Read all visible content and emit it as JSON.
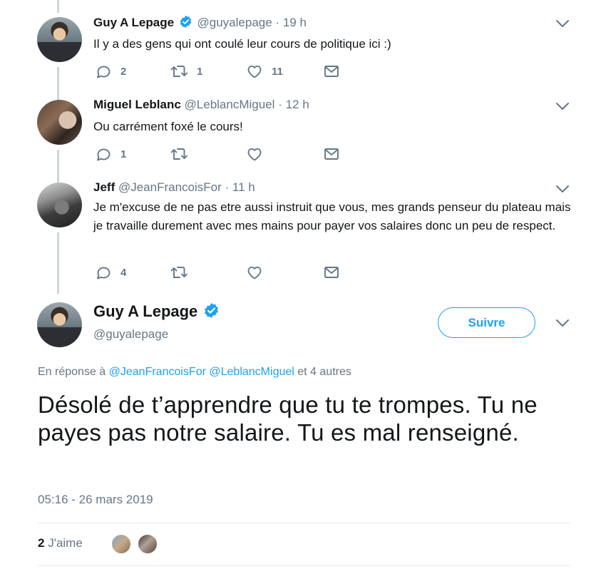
{
  "replies": [
    {
      "name": "Guy A Lepage",
      "verified": true,
      "handle": "@guyalepage",
      "time": "19 h",
      "text": "Il y a des gens qui ont coulé leur cours de politique ici :)",
      "reply_count": "2",
      "retweet_count": "1",
      "like_count": "11"
    },
    {
      "name": "Miguel Leblanc",
      "verified": false,
      "handle": "@LeblancMiguel",
      "time": "12 h",
      "text": "Ou carrément foxé le cours!",
      "reply_count": "1",
      "retweet_count": "",
      "like_count": ""
    },
    {
      "name": "Jeff",
      "verified": false,
      "handle": "@JeanFrancoisFor",
      "time": "11 h",
      "text": "Je m'excuse de ne pas etre aussi instruit que vous, mes grands penseur du plateau mais je travaille durement avec mes mains pour payer vos salaires donc un peu de respect.",
      "reply_count": "4",
      "retweet_count": "",
      "like_count": ""
    }
  ],
  "main": {
    "name": "Guy A Lepage",
    "handle": "@guyalepage",
    "follow_label": "Suivre",
    "reply_prefix": "En réponse à",
    "reply_link1": "@JeanFrancoisFor",
    "reply_link2": "@LeblancMiguel",
    "reply_suffix": "et 4 autres",
    "text": "Désolé de t’apprendre que tu te trompes. Tu ne payes pas notre salaire. Tu es mal renseigné.",
    "timestamp": "05:16 - 26 mars 2019",
    "likes_count": "2",
    "likes_label": "J'aime"
  },
  "icons": {
    "reply": "reply-icon",
    "retweet": "retweet-icon",
    "like": "heart-icon",
    "message": "envelope-icon",
    "verified": "verified-badge-icon",
    "caret": "chevron-down-icon"
  },
  "colors": {
    "accent": "#1da1f2",
    "secondary_text": "#657786",
    "thread_line": "#ccd6dd"
  }
}
